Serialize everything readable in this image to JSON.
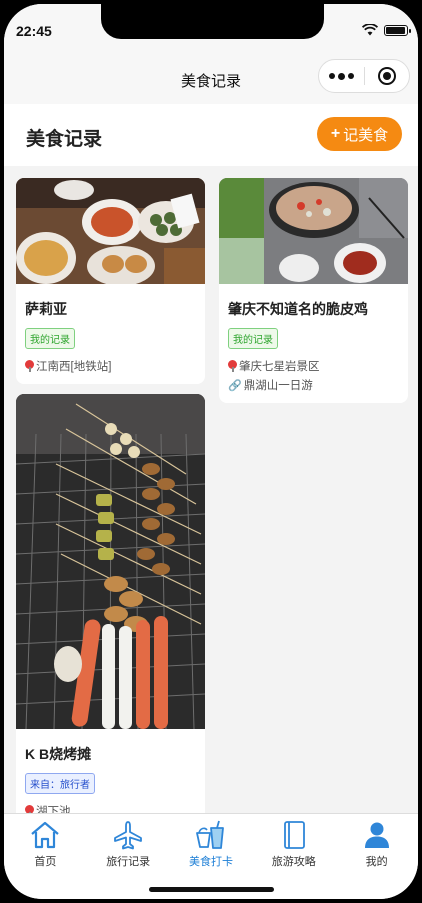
{
  "status": {
    "time": "22:45"
  },
  "navbar": {
    "title": "美食记录"
  },
  "header": {
    "title": "美食记录",
    "add_icon": "+",
    "add_label": "记美食"
  },
  "cards": [
    {
      "name": "萨莉亚",
      "tag": "我的记录",
      "location": "江南西[地铁站]"
    },
    {
      "name": "肇庆不知道名的脆皮鸡",
      "tag": "我的记录",
      "location": "肇庆七星岩景区",
      "trip": "鼎湖山一日游"
    },
    {
      "name": "K B烧烤摊",
      "tag": "来自：旅行者",
      "location": "湖下池"
    }
  ],
  "tabbar": {
    "items": [
      {
        "label": "首页",
        "icon": "home-icon"
      },
      {
        "label": "旅行记录",
        "icon": "airplane-icon"
      },
      {
        "label": "美食打卡",
        "icon": "food-drink-icon"
      },
      {
        "label": "旅游攻略",
        "icon": "guide-book-icon"
      },
      {
        "label": "我的",
        "icon": "user-icon"
      }
    ],
    "active": "美食打卡"
  },
  "colors": {
    "accent": "#f58a12",
    "tab_active": "#1e7fd6",
    "tag_green": "#2fa52f",
    "tag_blue": "#2750cc"
  }
}
